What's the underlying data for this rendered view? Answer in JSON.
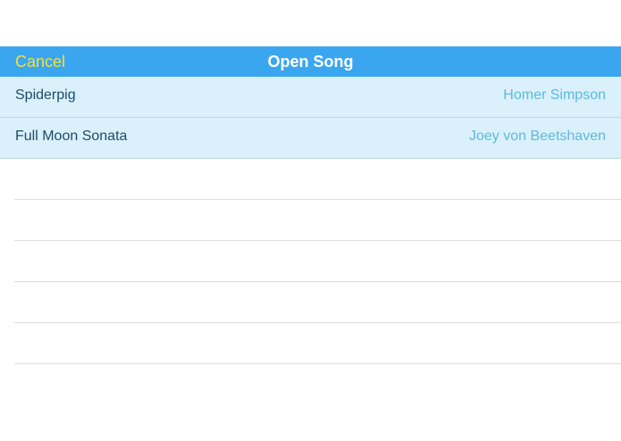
{
  "navbar": {
    "title": "Open Song",
    "cancel_label": "Cancel",
    "background_color": "#3ba6f0",
    "cancel_color": "#f4e03a"
  },
  "songs": [
    {
      "title": "Spiderpig",
      "artist": "Homer Simpson"
    },
    {
      "title": "Full Moon Sonata",
      "artist": "Joey von Beetshaven"
    }
  ],
  "colors": {
    "row_background": "#daf0fb",
    "title_text": "#1d4b68",
    "artist_text": "#5fb9dc"
  }
}
